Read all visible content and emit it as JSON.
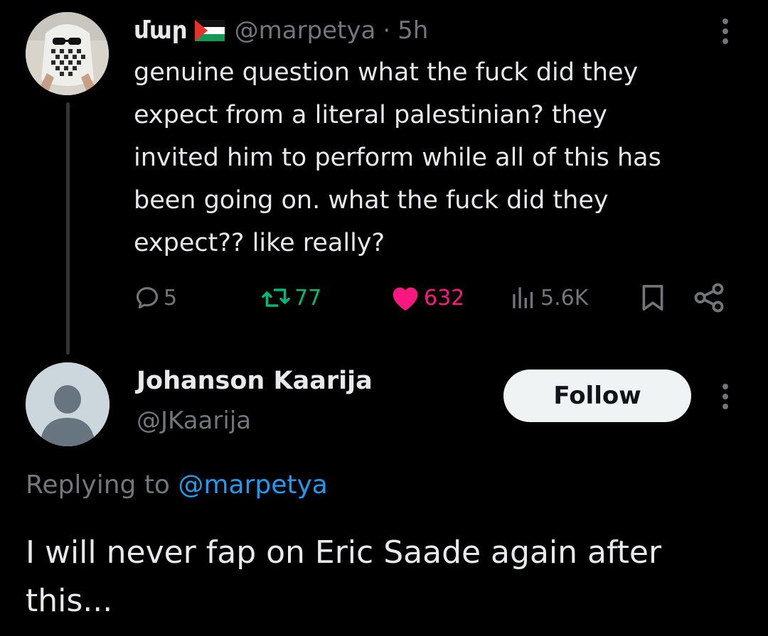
{
  "parent_tweet": {
    "display_name": "մար",
    "flag_icon": "palestine-flag-emoji",
    "handle": "@marpetya",
    "separator": "·",
    "time": "5h",
    "text": "genuine question what the fuck did they\nexpect from a literal palestinian? they\ninvited him to perform while all of this has\nbeen going on. what the fuck did they\nexpect?? like really?",
    "actions": {
      "reply_count": "5",
      "retweet_count": "77",
      "like_count": "632",
      "view_count": "5.6K"
    },
    "colors": {
      "retweet": "#00ba7c",
      "like": "#f91880",
      "muted": "#71767b"
    }
  },
  "reply_tweet": {
    "display_name": "Johanson Kaarija",
    "handle": "@JKaarija",
    "follow_label": "Follow",
    "replying_prefix": "Replying to ",
    "replying_to": "@marpetya",
    "text": "I will never fap on Eric Saade again after\nthis...",
    "colors": {
      "mention": "#1d9bf0",
      "button_bg": "#eff3f4"
    }
  }
}
